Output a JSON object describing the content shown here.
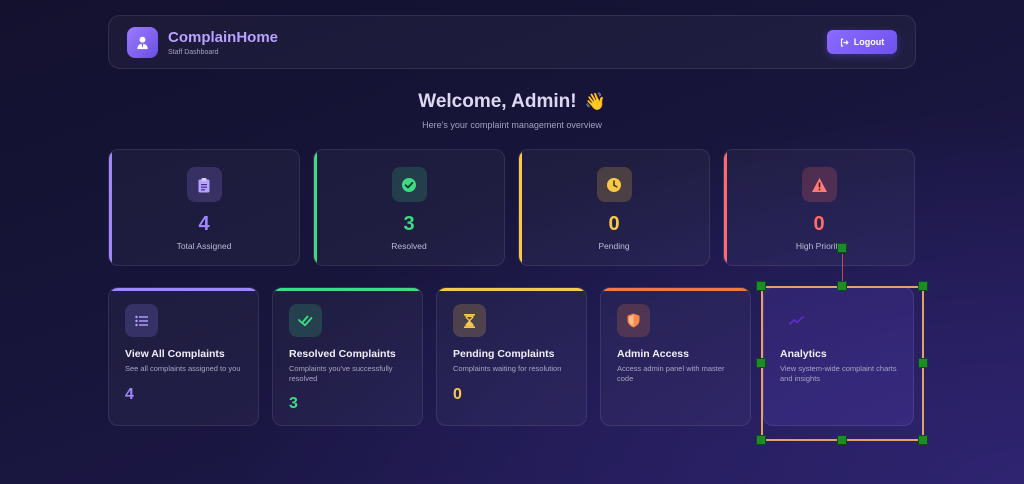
{
  "header": {
    "brand_title": "ComplainHome",
    "brand_subtitle": "Staff Dashboard",
    "logout_label": "Logout"
  },
  "welcome": {
    "title": "Welcome, Admin!",
    "emoji": "👋",
    "subtitle": "Here's your complaint management overview"
  },
  "stats": [
    {
      "value": "4",
      "label": "Total Assigned",
      "icon": "clipboard-icon",
      "color": "#9d86ff"
    },
    {
      "value": "3",
      "label": "Resolved",
      "icon": "check-circle-icon",
      "color": "#3ddc84"
    },
    {
      "value": "0",
      "label": "Pending",
      "icon": "clock-icon",
      "color": "#f7c948"
    },
    {
      "value": "0",
      "label": "High Priority",
      "icon": "warning-icon",
      "color": "#ff6b6b"
    }
  ],
  "cards": [
    {
      "title": "View All Complaints",
      "desc": "See all complaints assigned to you",
      "value": "4",
      "icon": "list-icon",
      "color": "#9d86ff"
    },
    {
      "title": "Resolved Complaints",
      "desc": "Complaints you've successfully resolved",
      "value": "3",
      "icon": "double-check-icon",
      "color": "#3ddc84"
    },
    {
      "title": "Pending Complaints",
      "desc": "Complaints waiting for resolution",
      "value": "0",
      "icon": "hourglass-icon",
      "color": "#f7c948"
    },
    {
      "title": "Admin Access",
      "desc": "Access admin panel with master code",
      "value": "",
      "icon": "shield-icon",
      "color": "#f07b3f"
    },
    {
      "title": "Analytics",
      "desc": "View system-wide complaint charts and insights",
      "value": "",
      "icon": "chart-icon",
      "color": "#7b55e0"
    }
  ],
  "colors": {
    "brand": "#b7a2ff",
    "button": "#7d5ff5",
    "selection_frame": "#e5a06a",
    "handle": "#1e8a2a"
  }
}
